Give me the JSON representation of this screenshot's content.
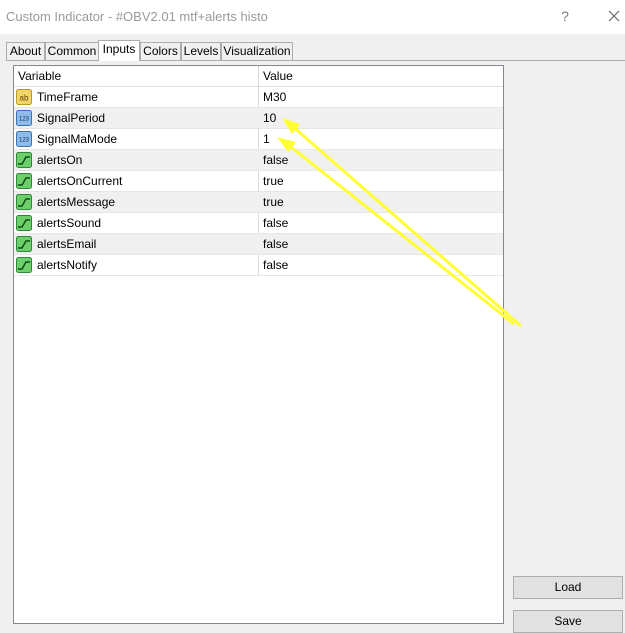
{
  "window": {
    "title": "Custom Indicator - #OBV2.01 mtf+alerts histo",
    "help_label": "?"
  },
  "tabs": [
    {
      "label": "About"
    },
    {
      "label": "Common"
    },
    {
      "label": "Inputs",
      "active": true
    },
    {
      "label": "Colors"
    },
    {
      "label": "Levels"
    },
    {
      "label": "Visualization"
    }
  ],
  "grid": {
    "headers": {
      "variable": "Variable",
      "value": "Value"
    },
    "rows": [
      {
        "icon": "string-icon",
        "icon_text": "ab",
        "variable": "TimeFrame",
        "value": "M30"
      },
      {
        "icon": "integer-icon",
        "icon_text": "123",
        "variable": "SignalPeriod",
        "value": "10"
      },
      {
        "icon": "integer-icon",
        "icon_text": "123",
        "variable": "SignalMaMode",
        "value": "1"
      },
      {
        "icon": "boolean-icon",
        "variable": "alertsOn",
        "value": "false"
      },
      {
        "icon": "boolean-icon",
        "variable": "alertsOnCurrent",
        "value": "true"
      },
      {
        "icon": "boolean-icon",
        "variable": "alertsMessage",
        "value": "true"
      },
      {
        "icon": "boolean-icon",
        "variable": "alertsSound",
        "value": "false"
      },
      {
        "icon": "boolean-icon",
        "variable": "alertsEmail",
        "value": "false"
      },
      {
        "icon": "boolean-icon",
        "variable": "alertsNotify",
        "value": "false"
      }
    ]
  },
  "buttons": {
    "load": "Load",
    "save": "Save"
  },
  "colors": {
    "annotation_arrow": "#ffff33",
    "boolean_icon": "#3fb34f",
    "integer_icon": "#5b9bd5",
    "string_icon": "#e8c547"
  }
}
